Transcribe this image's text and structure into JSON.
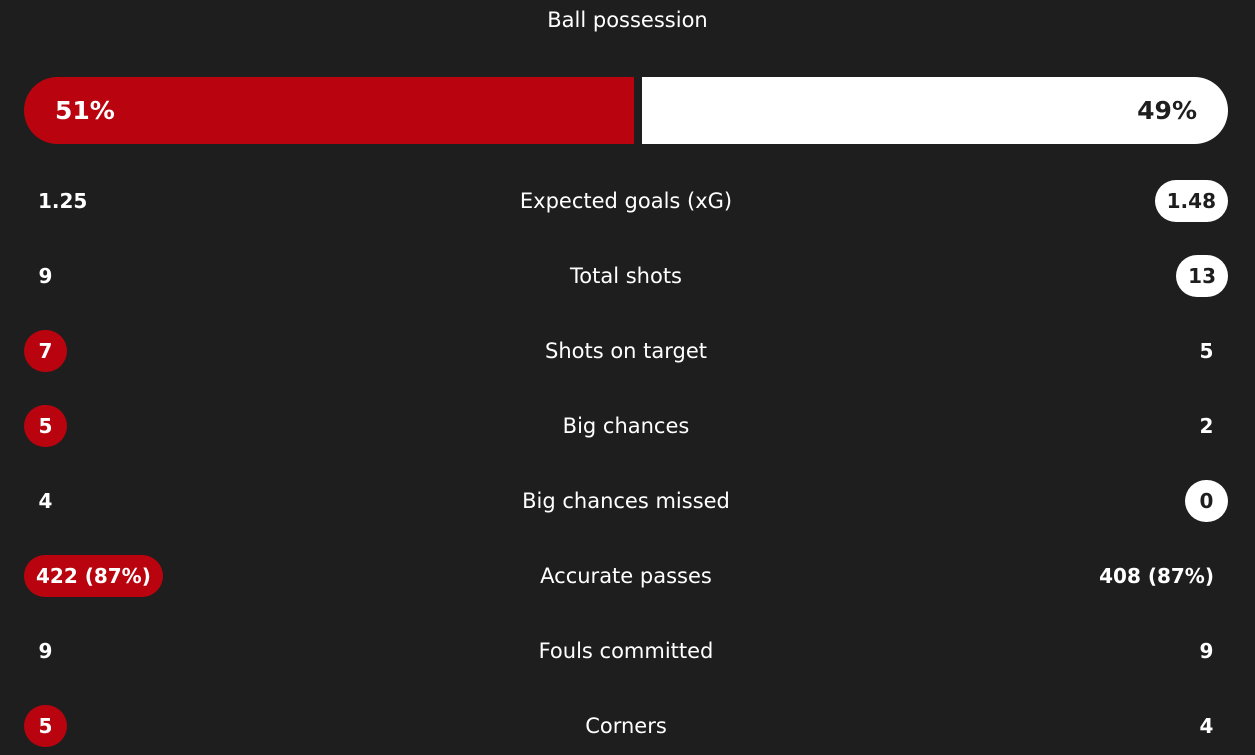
{
  "colors": {
    "background": "#1e1e1e",
    "home": "#b9040f",
    "away": "#ffffff"
  },
  "possession": {
    "title": "Ball possession",
    "home_percent": 51,
    "away_percent": 49,
    "home_label": "51%",
    "away_label": "49%"
  },
  "stats": [
    {
      "label": "Expected goals (xG)",
      "home": "1.25",
      "away": "1.48",
      "highlight": "away"
    },
    {
      "label": "Total shots",
      "home": "9",
      "away": "13",
      "highlight": "away"
    },
    {
      "label": "Shots on target",
      "home": "7",
      "away": "5",
      "highlight": "home"
    },
    {
      "label": "Big chances",
      "home": "5",
      "away": "2",
      "highlight": "home"
    },
    {
      "label": "Big chances missed",
      "home": "4",
      "away": "0",
      "highlight": "away"
    },
    {
      "label": "Accurate passes",
      "home": "422 (87%)",
      "away": "408 (87%)",
      "highlight": "home"
    },
    {
      "label": "Fouls committed",
      "home": "9",
      "away": "9",
      "highlight": "none"
    },
    {
      "label": "Corners",
      "home": "5",
      "away": "4",
      "highlight": "home"
    }
  ]
}
